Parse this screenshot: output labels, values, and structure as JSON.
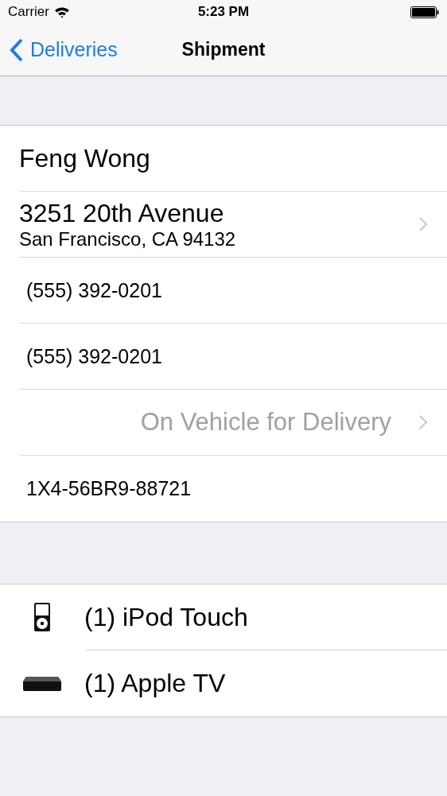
{
  "status_bar": {
    "carrier": "Carrier",
    "time": "5:23 PM"
  },
  "nav_bar": {
    "back": "Deliveries",
    "title": "Shipment"
  },
  "details": [
    {
      "kind": "name",
      "text": "Feng Wong"
    },
    {
      "kind": "address",
      "line1": "3251 20th Avenue",
      "line2": "San Francisco, CA 94132"
    },
    {
      "kind": "phone",
      "text": "(555) 392-0201"
    },
    {
      "kind": "phone",
      "text": "(555) 392-0201"
    },
    {
      "kind": "status",
      "text": "On Vehicle for Delivery"
    },
    {
      "kind": "tracking",
      "text": "1X4-56BR9-88721"
    }
  ],
  "items": [
    {
      "kind": "ipod",
      "label": "(1) iPod Touch"
    },
    {
      "kind": "appletv",
      "label": "(1) Apple TV"
    }
  ]
}
